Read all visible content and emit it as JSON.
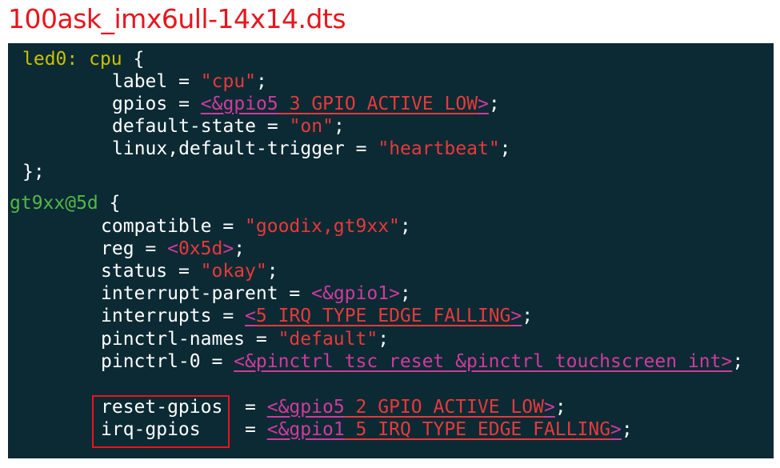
{
  "title": "100ask_imx6ull-14x14.dts",
  "colors": {
    "title": "#e8141c",
    "background": "#0b2a34",
    "label": "#c9c200",
    "node": "#53b848",
    "string": "#e8393a",
    "reference": "#d23a9d",
    "text": "#ffffff",
    "highlight_box": "#e8141c"
  },
  "code": {
    "led0_label": "led0:",
    "led0_node": "cpu",
    "open_brace": "{",
    "close_brace": "};",
    "led0_props": {
      "label_key": "label",
      "label_val": "\"cpu\"",
      "gpios_key": "gpios",
      "gpios_ref": "&gpio5",
      "gpios_num": "3",
      "gpios_flag": "GPIO_ACTIVE_LOW",
      "default_state_key": "default-state",
      "default_state_val": "\"on\"",
      "trigger_key": "linux,default-trigger",
      "trigger_val": "\"heartbeat\""
    },
    "gt9xx_node": "gt9xx@5d",
    "gt9xx_props": {
      "compatible_key": "compatible",
      "compatible_val": "\"goodix,gt9xx\"",
      "reg_key": "reg",
      "reg_val": "0x5d",
      "status_key": "status",
      "status_val": "\"okay\"",
      "interrupt_parent_key": "interrupt-parent",
      "interrupt_parent_ref": "&gpio1",
      "interrupts_key": "interrupts",
      "interrupts_num": "5",
      "interrupts_flag": "IRQ_TYPE_EDGE_FALLING",
      "pinctrl_names_key": "pinctrl-names",
      "pinctrl_names_val": "\"default\"",
      "pinctrl_0_key": "pinctrl-0",
      "pinctrl_0_ref1": "&pinctrl_tsc_reset",
      "pinctrl_0_ref2": "&pinctrl_touchscreen_int",
      "reset_gpios_key": "reset-gpios",
      "reset_gpios_ref": "&gpio5",
      "reset_gpios_num": "2",
      "reset_gpios_flag": "GPIO_ACTIVE_LOW",
      "irq_gpios_key": "irq-gpios",
      "irq_gpios_ref": "&gpio1",
      "irq_gpios_num": "5",
      "irq_gpios_flag": "IRQ_TYPE_EDGE_FALLING"
    }
  }
}
